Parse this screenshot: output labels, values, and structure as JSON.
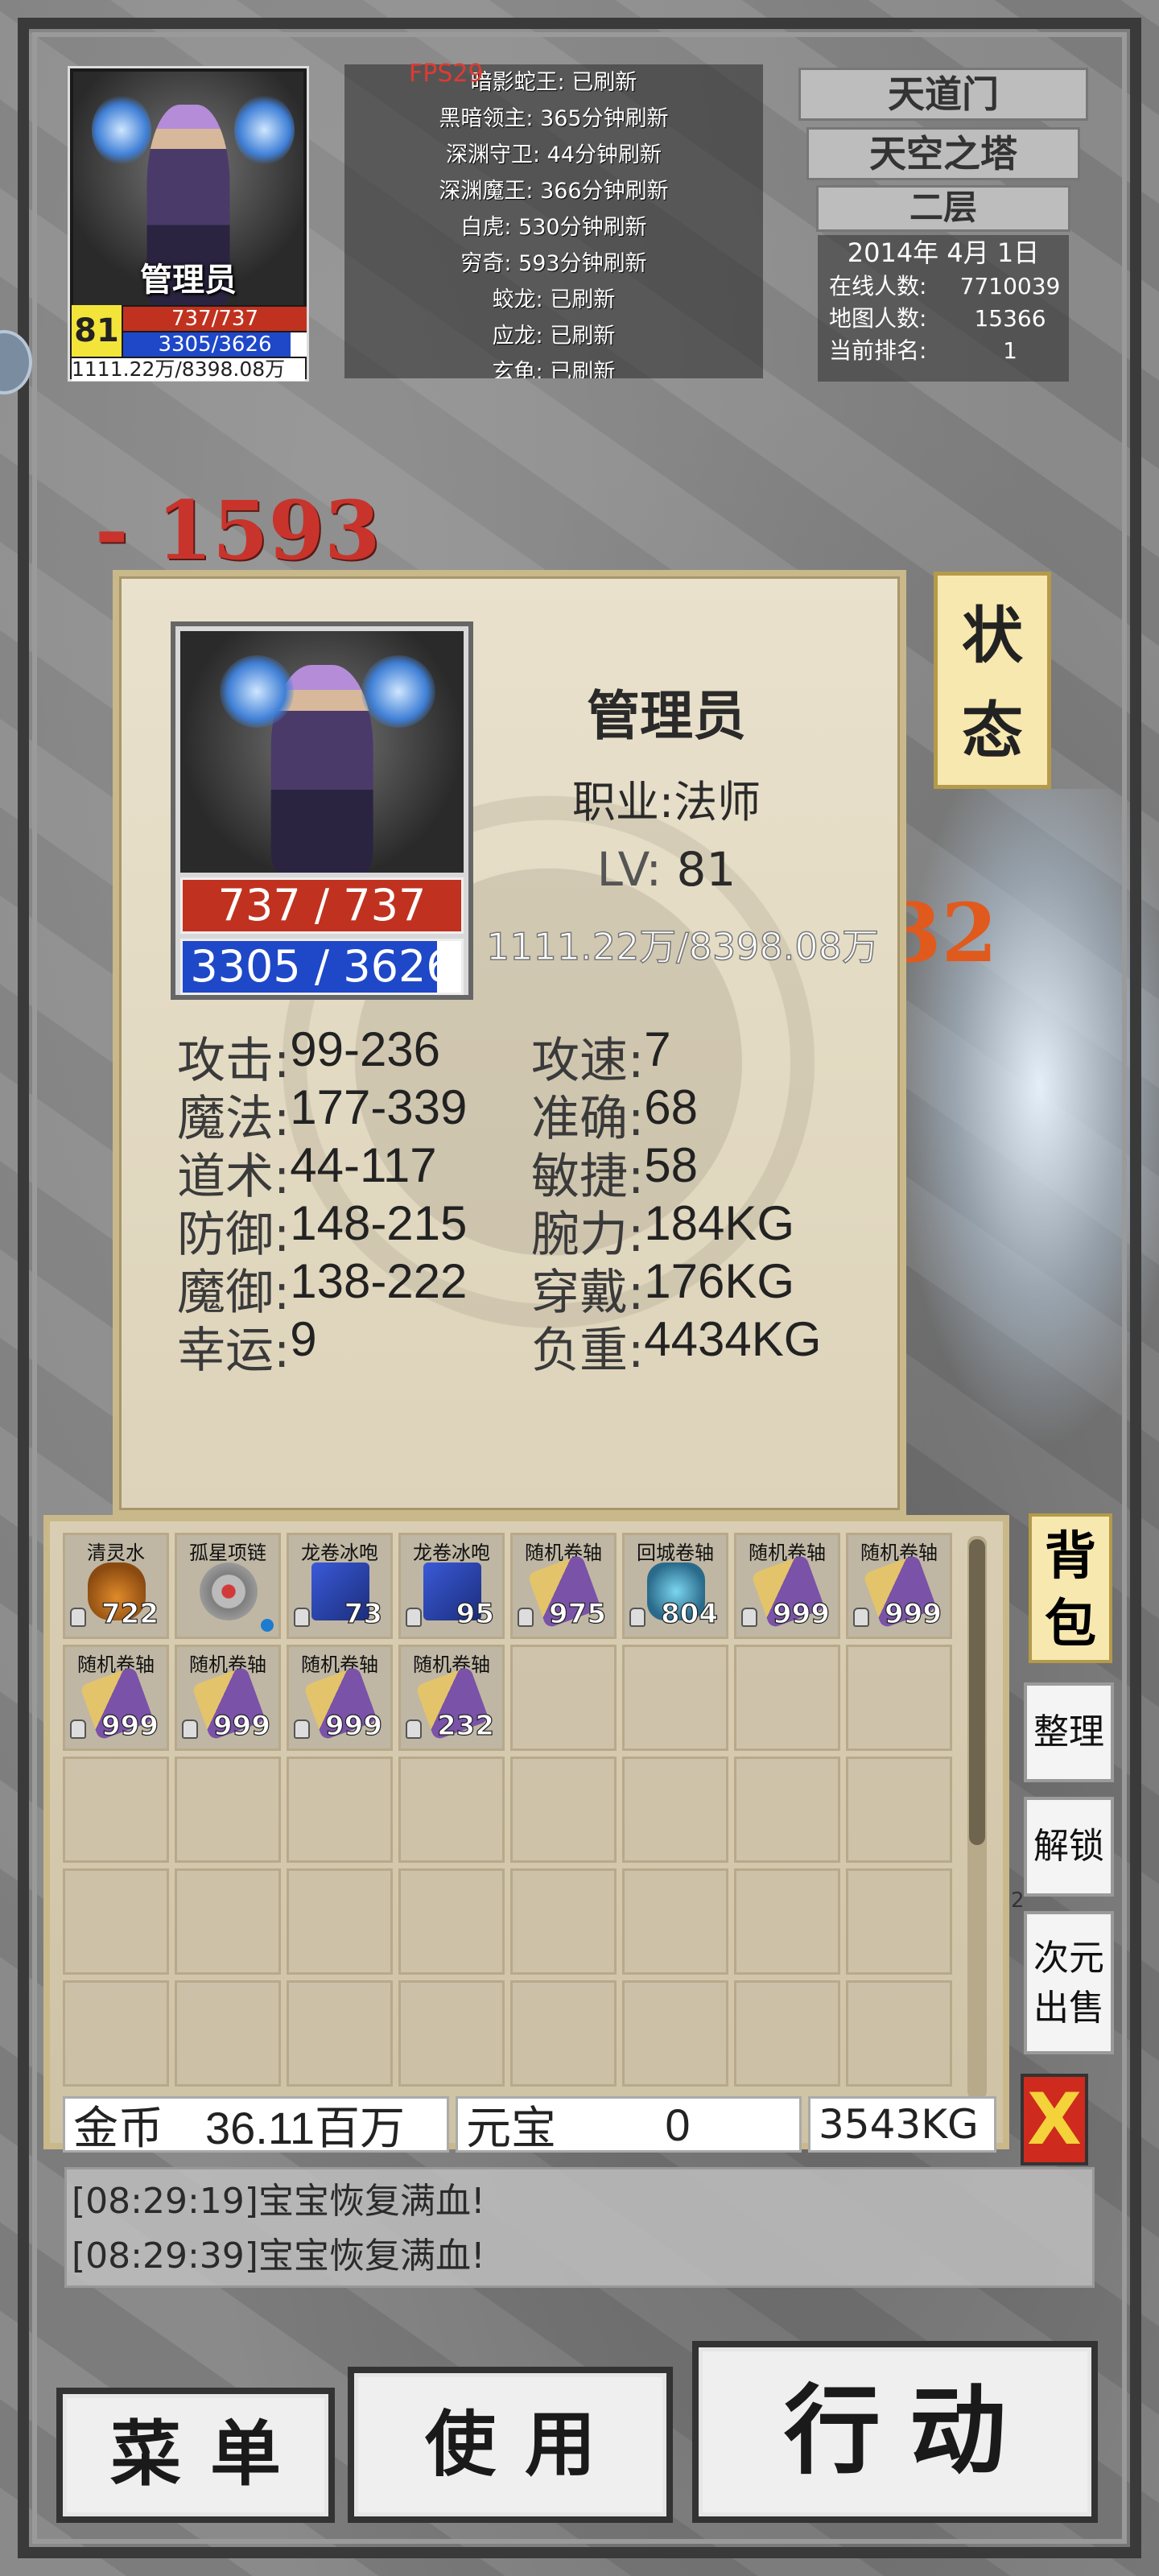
{
  "hud": {
    "name": "管理员",
    "level": "81",
    "hp": "737/737",
    "mp": "3305/3626",
    "mp_fraction": 0.912,
    "exp": "1111.22万/8398.08万",
    "fps": "FPS29"
  },
  "boss_timers": [
    "暗影蛇王: 已刷新",
    "黑暗领主: 365分钟刷新",
    "深渊守卫: 44分钟刷新",
    "深渊魔王: 366分钟刷新",
    "白虎: 530分钟刷新",
    "穷奇: 593分钟刷新",
    "蛟龙: 已刷新",
    "应龙: 已刷新",
    "玄龟: 已刷新"
  ],
  "location": {
    "sect": "天道门",
    "map": "天空之塔",
    "floor": "二层",
    "date": "2014年 4月 1日",
    "online_label": "在线人数:",
    "online_value": "7710039",
    "map_label": "地图人数:",
    "map_value": "15366",
    "rank_label": "当前排名:",
    "rank_value": "1"
  },
  "combat": {
    "damage": "- 1593",
    "damage_right": "32"
  },
  "status": {
    "tab_label_1": "状",
    "tab_label_2": "态",
    "name": "管理员",
    "job": "职业:法师",
    "lv_label": "LV:",
    "lv_value": "81",
    "hp": "737 / 737",
    "mp": "3305 / 3626",
    "mp_fraction": 0.912,
    "exp": "1111.22万/8398.08万",
    "stats": [
      {
        "k": "攻击:",
        "v": "99-236",
        "k2": "攻速:",
        "v2": "7"
      },
      {
        "k": "魔法:",
        "v": "177-339",
        "k2": "准确:",
        "v2": "68"
      },
      {
        "k": "道术:",
        "v": "44-117",
        "k2": "敏捷:",
        "v2": "58"
      },
      {
        "k": "防御:",
        "v": "148-215",
        "k2": "腕力:",
        "v2": "184KG"
      },
      {
        "k": "魔御:",
        "v": "138-222",
        "k2": "穿戴:",
        "v2": "176KG"
      },
      {
        "k": "幸运:",
        "v": "9",
        "k2": "负重:",
        "v2": "4434KG"
      }
    ]
  },
  "bag": {
    "tab_label_1": "背",
    "tab_label_2": "包",
    "items": [
      {
        "name": "清灵水",
        "count": "722",
        "icon": "potion-icon"
      },
      {
        "name": "孤星项链",
        "count": "",
        "icon": "necklace-icon"
      },
      {
        "name": "龙卷冰咆",
        "count": "73",
        "icon": "spellbook-icon"
      },
      {
        "name": "龙卷冰咆",
        "count": "95",
        "icon": "spellbook-icon"
      },
      {
        "name": "随机卷轴",
        "count": "975",
        "icon": "scroll-icon"
      },
      {
        "name": "回城卷轴",
        "count": "804",
        "icon": "return-scroll-icon"
      },
      {
        "name": "随机卷轴",
        "count": "999",
        "icon": "scroll-icon"
      },
      {
        "name": "随机卷轴",
        "count": "999",
        "icon": "scroll-icon"
      },
      {
        "name": "随机卷轴",
        "count": "999",
        "icon": "scroll-icon"
      },
      {
        "name": "随机卷轴",
        "count": "999",
        "icon": "scroll-icon"
      },
      {
        "name": "随机卷轴",
        "count": "999",
        "icon": "scroll-icon"
      },
      {
        "name": "随机卷轴",
        "count": "232",
        "icon": "scroll-icon"
      }
    ],
    "gold_label": "金币",
    "gold_value": "36.11百万",
    "yuanbao_label": "元宝",
    "yuanbao_value": "0",
    "weight": "3543KG",
    "sort_label": "整理",
    "unlock_label": "解锁",
    "sell_label_1": "次元",
    "sell_label_2": "出售",
    "close_label": "X",
    "page_marker": "2"
  },
  "log": [
    "[08:29:19]宝宝恢复满血!",
    "[08:29:39]宝宝恢复满血!"
  ],
  "buttons": {
    "menu": "菜单",
    "use": "使用",
    "action": "行动"
  }
}
